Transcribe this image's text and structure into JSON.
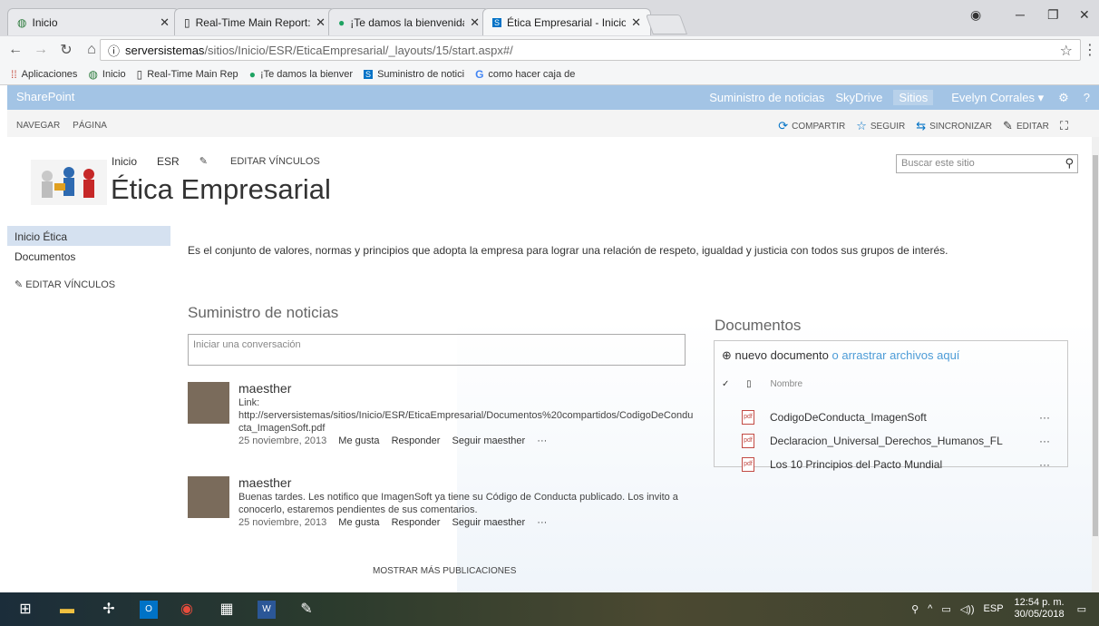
{
  "browser": {
    "tabs": [
      {
        "label": "Inicio",
        "icon": "sharepoint-circle-icon"
      },
      {
        "label": "Real-Time Main Report: A",
        "icon": "page-icon"
      },
      {
        "label": "¡Te damos la bienvenida a",
        "icon": "green-circle-icon"
      },
      {
        "label": "Ética Empresarial - Inicio",
        "icon": "sharepoint-icon"
      }
    ],
    "url_host": "serversistemas",
    "url_path": "/sitios/Inicio/ESR/EticaEmpresarial/_layouts/15/start.aspx#/",
    "bookmarks": [
      {
        "label": "Aplicaciones",
        "icon": "apps-grid-icon"
      },
      {
        "label": "Inicio",
        "icon": "sharepoint-circle-icon"
      },
      {
        "label": "Real-Time Main Rep",
        "icon": "page-icon"
      },
      {
        "label": "¡Te damos la bienver",
        "icon": "green-circle-icon"
      },
      {
        "label": "Suministro de notici",
        "icon": "sharepoint-icon"
      },
      {
        "label": "como hacer caja de",
        "icon": "google-icon"
      }
    ]
  },
  "suitebar": {
    "brand": "SharePoint",
    "links": [
      "Suministro de noticias",
      "SkyDrive",
      "Sitios"
    ],
    "user": "Evelyn Corrales ▾"
  },
  "ribbon": {
    "left": [
      "NAVEGAR",
      "PÁGINA"
    ],
    "right": [
      "COMPARTIR",
      "SEGUIR",
      "SINCRONIZAR",
      "EDITAR"
    ]
  },
  "site": {
    "crumbs": [
      "Inicio",
      "ESR"
    ],
    "edit_links": "EDITAR VÍNCULOS",
    "title": "Ética Empresarial",
    "search_placeholder": "Buscar este sitio"
  },
  "quicklaunch": {
    "items": [
      "Inicio Ética",
      "Documentos"
    ],
    "edit_links": "EDITAR VÍNCULOS"
  },
  "intro": "Es el conjunto de valores, normas y principios que adopta la empresa para lograr una relación de respeto, igualdad y justicia con todos sus grupos de interés.",
  "feed": {
    "title": "Suministro de noticias",
    "input_placeholder": "Iniciar una conversación",
    "posts": [
      {
        "author": "maesther",
        "line1": "Link:",
        "line2": "http://serversistemas/sitios/Inicio/ESR/EticaEmpresarial/Documentos%20compartidos/CodigoDeCondu",
        "line3": "cta_ImagenSoft.pdf",
        "date": "25 noviembre, 2013",
        "like": "Me gusta",
        "reply": "Responder",
        "follow": "Seguir maesther",
        "more": "···"
      },
      {
        "author": "maesther",
        "line1": "Buenas tardes. Les notifico que ImagenSoft ya tiene su Código de Conducta publicado. Los invito a",
        "line2": "conocerlo, estaremos pendientes de sus comentarios.",
        "date": "25 noviembre, 2013",
        "like": "Me gusta",
        "reply": "Responder",
        "follow": "Seguir maesther",
        "more": "···"
      }
    ],
    "more_posts": "MOSTRAR MÁS PUBLICACIONES"
  },
  "documents": {
    "title": "Documentos",
    "new_doc": "nuevo documento",
    "drag_text": "o arrastrar archivos aquí",
    "column_name": "Nombre",
    "files": [
      "CodigoDeConducta_ImagenSoft",
      "Declaracion_Universal_Derechos_Humanos_FL",
      "Los 10 Principios del Pacto Mundial"
    ],
    "ellipsis": "···"
  },
  "taskbar": {
    "lang": "ESP",
    "time": "12:54 p. m.",
    "date": "30/05/2018"
  }
}
